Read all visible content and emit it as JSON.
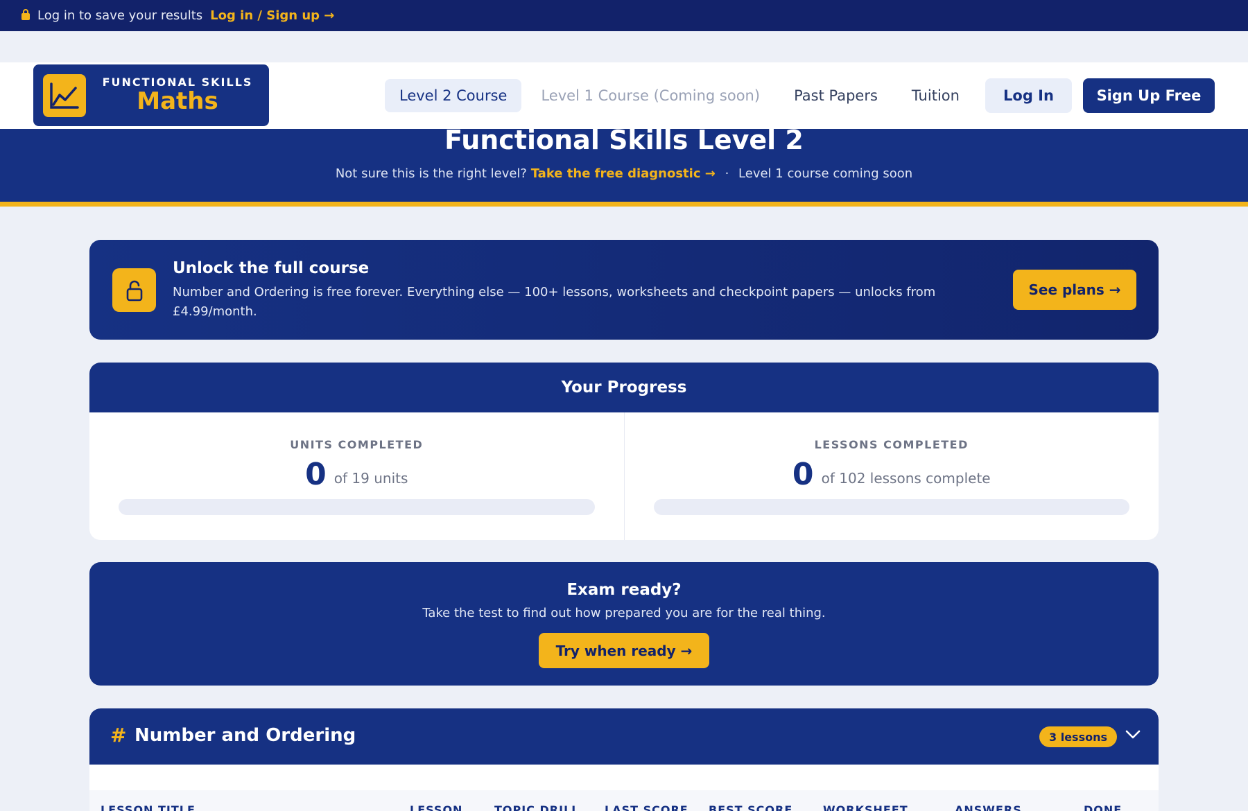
{
  "topbar": {
    "message": "Log in to save your results",
    "link": "Log in / Sign up →"
  },
  "logo": {
    "subtitle": "FUNCTIONAL SKILLS",
    "title": "Maths"
  },
  "nav": {
    "items": [
      {
        "label": "Level 2 Course",
        "state": "active"
      },
      {
        "label": "Level 1 Course (Coming soon)",
        "state": "disabled"
      },
      {
        "label": "Past Papers",
        "state": "normal"
      },
      {
        "label": "Tuition",
        "state": "normal"
      }
    ],
    "login": "Log In",
    "signup": "Sign Up Free"
  },
  "hero": {
    "title": "Functional Skills Level 2",
    "question": "Not sure this is the right level?",
    "diagnostic": "Take the free diagnostic →",
    "separator": "·",
    "note": "Level 1 course coming soon"
  },
  "unlock": {
    "title": "Unlock the full course",
    "description": "Number and Ordering is free forever. Everything else — 100+ lessons, worksheets and checkpoint papers — unlocks from £4.99/month.",
    "button": "See plans →"
  },
  "progress": {
    "title": "Your Progress",
    "units": {
      "label": "UNITS COMPLETED",
      "value": "0",
      "suffix": "of 19 units",
      "fraction": 0
    },
    "lessons": {
      "label": "LESSONS COMPLETED",
      "value": "0",
      "suffix": "of 102 lessons complete",
      "fraction": 0
    }
  },
  "exam": {
    "title": "Exam ready?",
    "subtitle": "Take the test to find out how prepared you are for the real thing.",
    "button": "Try when ready →"
  },
  "unit": {
    "icon": "#",
    "title": "Number and Ordering",
    "badge": "3 lessons",
    "columns": [
      "LESSON TITLE",
      "LESSON",
      "TOPIC DRILL",
      "LAST SCORE",
      "BEST SCORE",
      "WORKSHEET",
      "ANSWERS",
      "DONE"
    ]
  },
  "colors": {
    "navy": "#163183",
    "dark_navy": "#12226a",
    "accent": "#f3b41b",
    "background": "#edf0f7"
  },
  "icons": {
    "topbar": "lock-icon",
    "logo": "line-chart-icon",
    "unlock": "unlocked-padlock-icon",
    "unit_toggle": "chevron-down-icon"
  }
}
